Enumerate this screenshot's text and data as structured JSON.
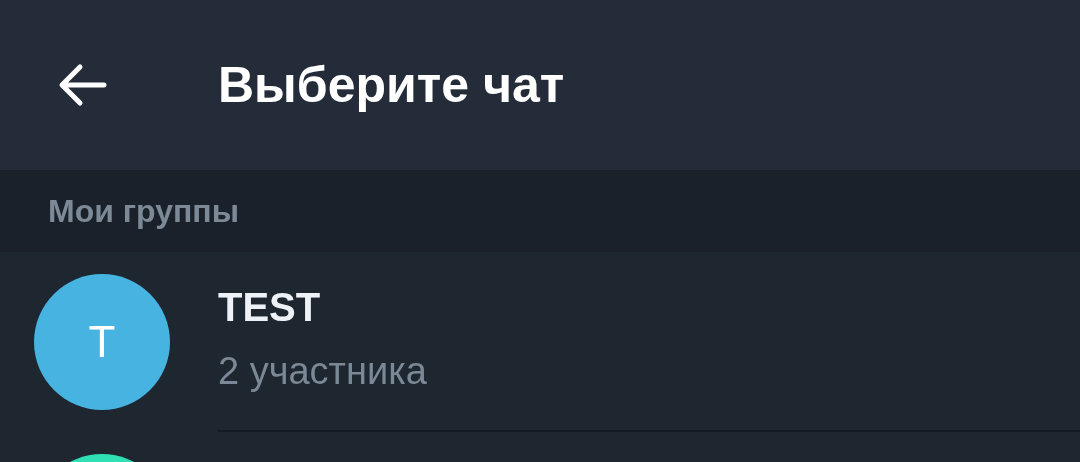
{
  "header": {
    "title": "Выберите чат"
  },
  "section": {
    "title": "Мои группы"
  },
  "chats": [
    {
      "initial": "T",
      "name": "TEST",
      "subtitle": "2 участника",
      "color": "#47b3e0"
    },
    {
      "color": "#2ee0b4"
    }
  ]
}
